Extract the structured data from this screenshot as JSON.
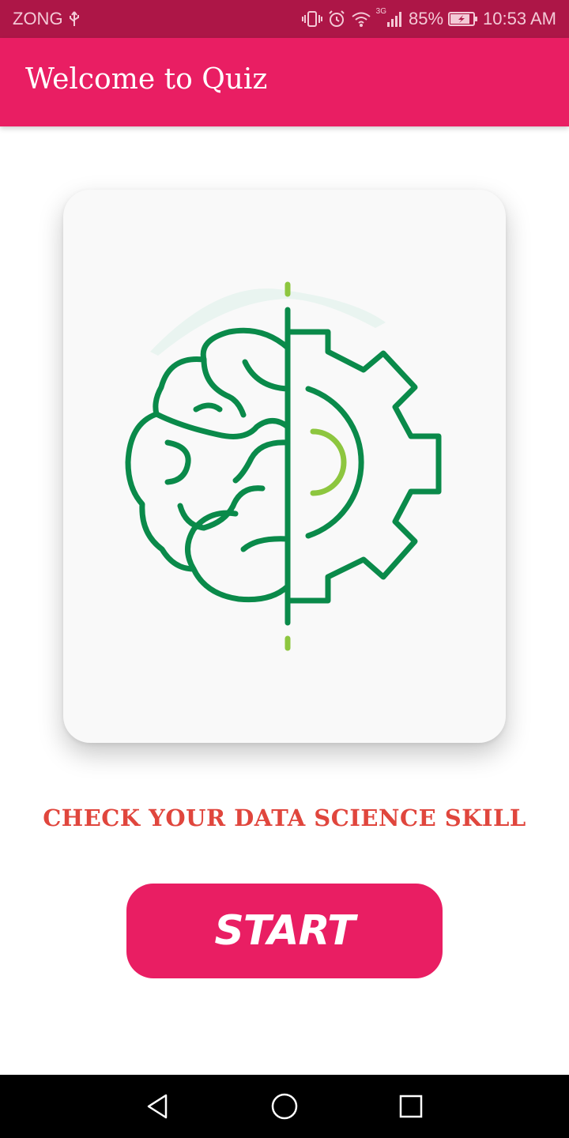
{
  "status_bar": {
    "carrier": "ZONG",
    "network": "3G",
    "battery": "85%",
    "time": "10:53 AM"
  },
  "app_bar": {
    "title": "Welcome to Quiz"
  },
  "card": {
    "illustration": "brain-gear-icon"
  },
  "tagline": "CHECK YOUR DATA SCIENCE SKILL",
  "start_button": {
    "label": "START"
  },
  "nav_bar": {
    "back": "back-icon",
    "home": "home-icon",
    "recents": "recents-icon"
  },
  "colors": {
    "status_bar": "#ad1647",
    "primary": "#e91e63",
    "tagline": "#e0463d",
    "icon_green": "#0a8a4a",
    "icon_lime": "#8dc63f"
  }
}
